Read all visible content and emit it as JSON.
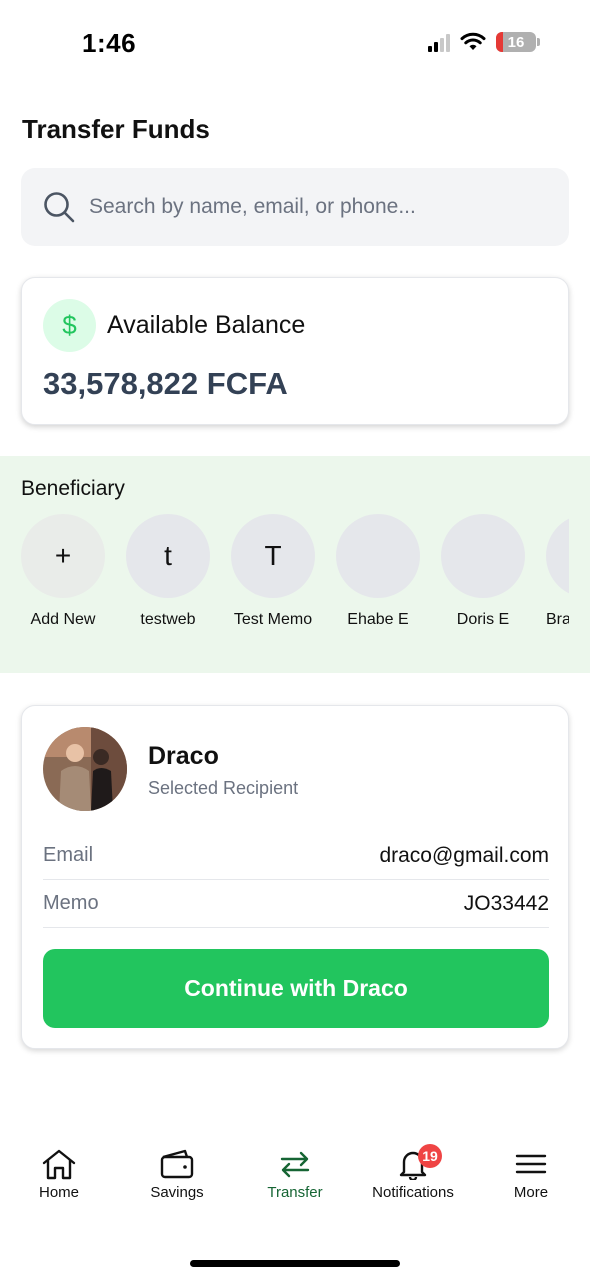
{
  "status_bar": {
    "time": "1:46",
    "battery": "16"
  },
  "page": {
    "title": "Transfer Funds"
  },
  "search": {
    "placeholder": "Search by name, email, or phone..."
  },
  "balance": {
    "label": "Available Balance",
    "amount": "33,578,822 FCFA",
    "icon": "dollar-sign-icon"
  },
  "beneficiaries": {
    "title": "Beneficiary",
    "items": [
      {
        "initial": "+",
        "label": "Add New"
      },
      {
        "initial": "t",
        "label": "testweb"
      },
      {
        "initial": "T",
        "label": "Test Memo"
      },
      {
        "initial": "",
        "label": "Ehabe E"
      },
      {
        "initial": "",
        "label": "Doris E"
      },
      {
        "initial": "",
        "label": "Bra"
      }
    ]
  },
  "recipient": {
    "name": "Draco",
    "subtitle": "Selected Recipient",
    "email_label": "Email",
    "email": "draco@gmail.com",
    "memo_label": "Memo",
    "memo": "JO33442",
    "continue_label": "Continue with Draco"
  },
  "nav": {
    "items": [
      {
        "label": "Home",
        "icon": "home-icon"
      },
      {
        "label": "Savings",
        "icon": "wallet-icon"
      },
      {
        "label": "Transfer",
        "icon": "transfer-icon"
      },
      {
        "label": "Notifications",
        "icon": "bell-icon",
        "badge": "19"
      },
      {
        "label": "More",
        "icon": "menu-icon"
      }
    ]
  },
  "colors": {
    "accent": "#22c55e",
    "active_nav": "#166534",
    "badge": "#ef4444",
    "beneficiary_bg": "#ecf7ec"
  }
}
